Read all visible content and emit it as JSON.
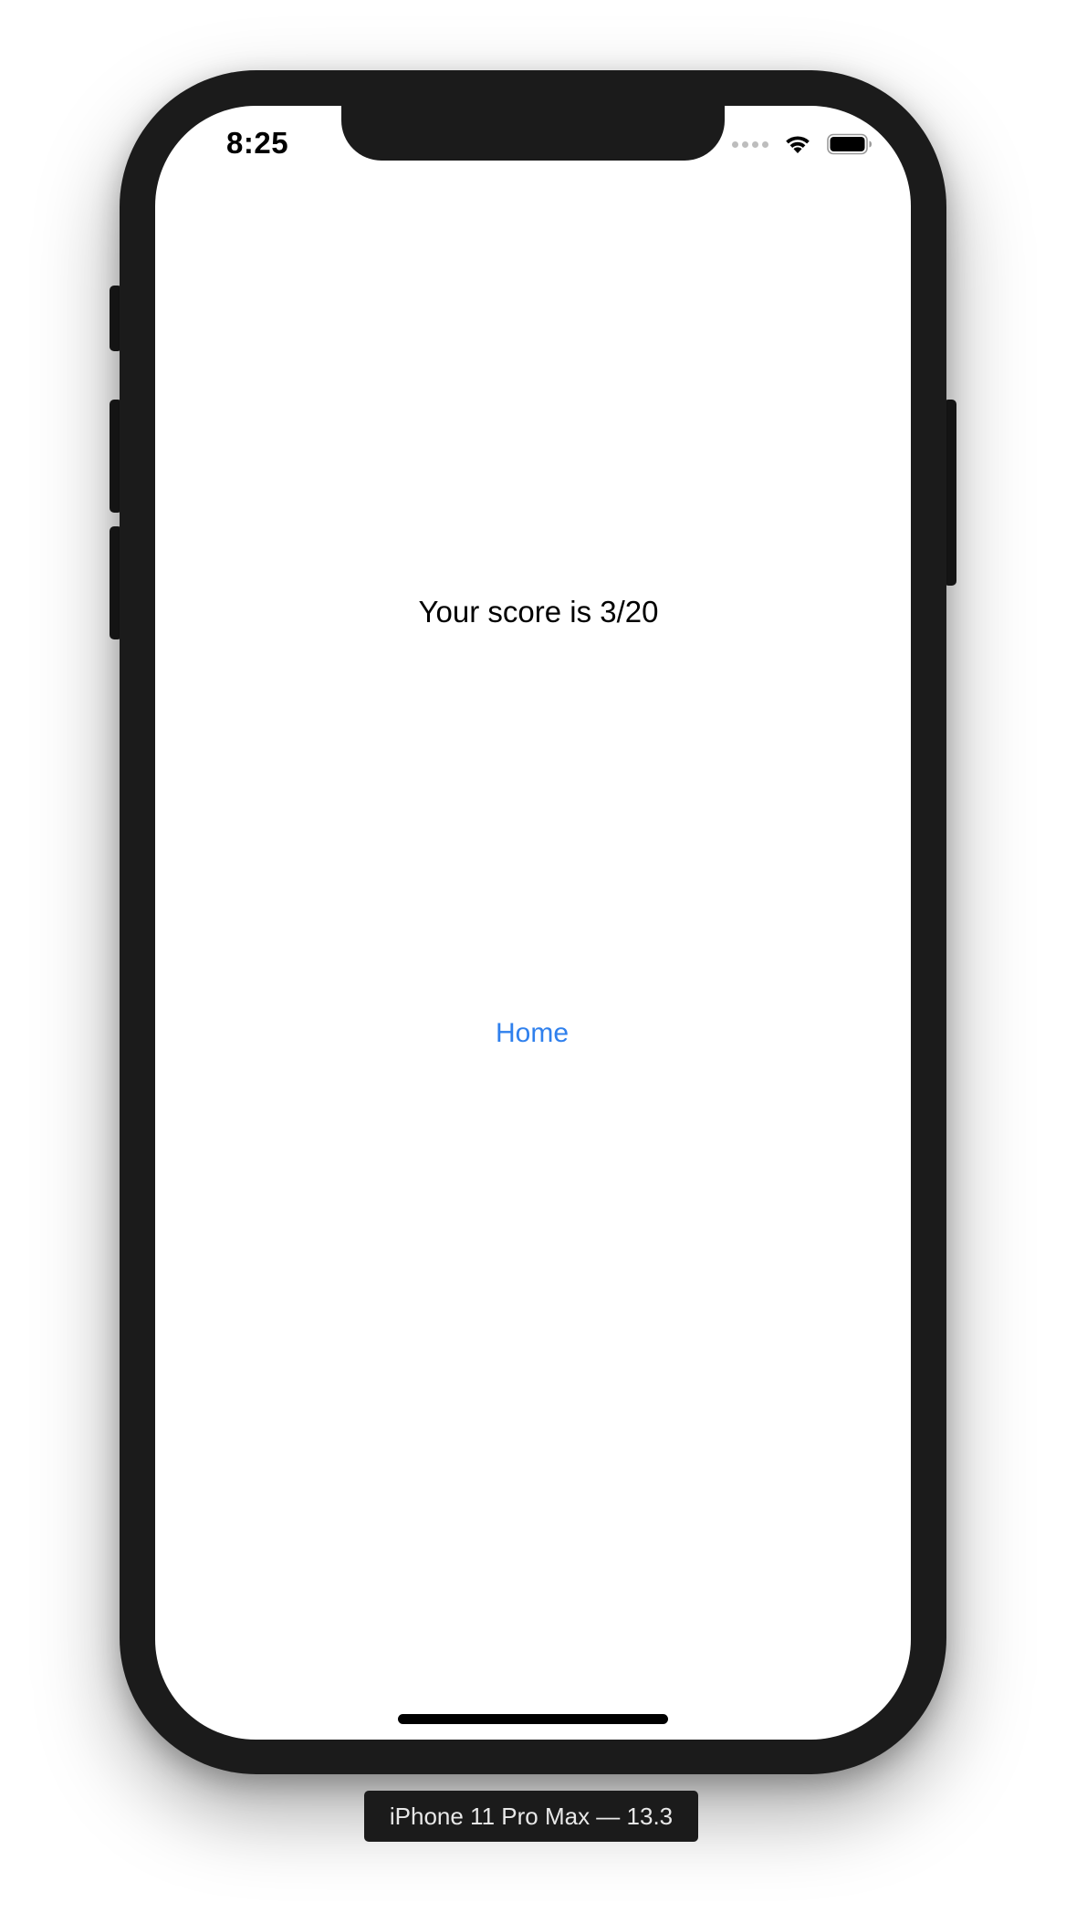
{
  "status_bar": {
    "time": "8:25",
    "icons": [
      "cellular-signal-icon",
      "wifi-icon",
      "battery-icon"
    ]
  },
  "main": {
    "score_text": "Your score is 3/20",
    "home_label": "Home"
  },
  "device_label": "iPhone 11 Pro Max — 13.3",
  "colors": {
    "accent": "#2f80ed",
    "frame": "#1b1b1b",
    "text": "#000000"
  }
}
